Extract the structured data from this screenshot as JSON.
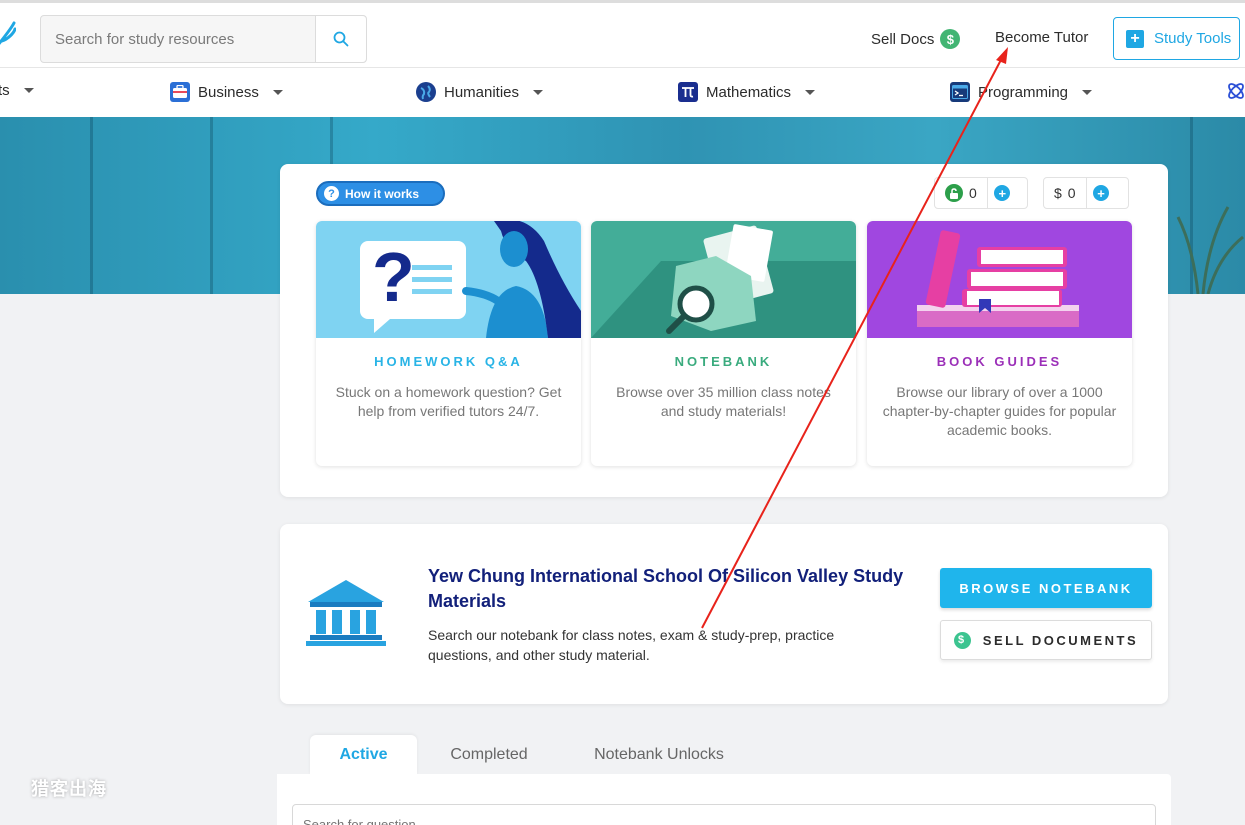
{
  "header": {
    "search_placeholder": "Search for study resources",
    "sell_docs": "Sell Docs",
    "dollar_glyph": "$",
    "become_tutor": "Become Tutor",
    "study_tools": "Study Tools",
    "plus_glyph": "+"
  },
  "subjects": [
    {
      "label": "ts",
      "icon": "partial-icon"
    },
    {
      "label": "Business",
      "icon": "briefcase-icon"
    },
    {
      "label": "Humanities",
      "icon": "globe-icon"
    },
    {
      "label": "Mathematics",
      "icon": "pi-icon"
    },
    {
      "label": "Programming",
      "icon": "terminal-icon"
    }
  ],
  "main": {
    "how_it_works": "How it works",
    "question_glyph": "?",
    "unlock_count": "0",
    "money_symbol": "$",
    "money_count": "0",
    "add_glyph": "+",
    "features": [
      {
        "title": "HOMEWORK Q&A",
        "desc": "Stuck on a homework question? Get help from verified tutors 24/7.",
        "color": "#29b4e6"
      },
      {
        "title": "NOTEBANK",
        "desc": "Browse over 35 million class notes and study materials!",
        "color": "#3aab7e"
      },
      {
        "title": "BOOK GUIDES",
        "desc": "Browse our library of over a 1000 chapter-by-chapter guides for popular academic books.",
        "color": "#9b2fb8"
      }
    ]
  },
  "school": {
    "title": "Yew Chung International School Of Silicon Valley Study Materials",
    "description": "Search our notebank for class notes, exam & study-prep, practice questions, and other study material.",
    "browse_button": "BROWSE NOTEBANK",
    "sell_button": "SELL DOCUMENTS"
  },
  "tabs": {
    "items": [
      "Active",
      "Completed",
      "Notebank Unlocks"
    ],
    "active": "Active",
    "search_placeholder": "Search for question"
  },
  "watermark": "猎客出海",
  "colors": {
    "accent": "#1fa7e3",
    "title_navy": "#12207a",
    "annotation_arrow": "#e8231b"
  }
}
